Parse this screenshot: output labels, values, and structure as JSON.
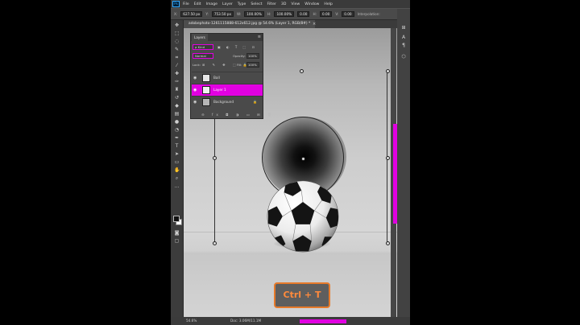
{
  "app": {
    "logo": "Ps",
    "menu": [
      "File",
      "Edit",
      "Image",
      "Layer",
      "Type",
      "Select",
      "Filter",
      "3D",
      "View",
      "Window",
      "Help"
    ]
  },
  "options_bar": {
    "x_label": "X:",
    "x": "627.50 px",
    "y_label": "Y:",
    "y": "753.50 px",
    "w_label": "W:",
    "w": "100.00%",
    "h_label": "H:",
    "h": "100.00%",
    "angle": "0.00",
    "hskew_label": "H:",
    "hskew": "0.00",
    "vskew_label": "V:",
    "vskew": "0.00",
    "interp": "Interpolation:"
  },
  "document": {
    "tab_title": "adobephoto-1261115888-612x612.jpg @ 54.6% (Layer 1, RGB/8#) *",
    "close": "×"
  },
  "layers_panel": {
    "tab": "Layers",
    "menu_icon": "≡",
    "kind": "ρ Kind",
    "filter_icons": "▣ ◐ T ⬚ ⊡",
    "blend_mode": "Normal",
    "opacity_label": "Opacity:",
    "opacity": "100%",
    "lock_label": "Lock:",
    "lock_icons": "⊞ ✎ ✥ ⬚ 🔒",
    "fill_label": "Fill:",
    "fill": "100%",
    "layers": [
      {
        "name": "Ball",
        "selected": false
      },
      {
        "name": "Layer 1",
        "selected": true
      },
      {
        "name": "Background",
        "selected": false,
        "locked": true
      }
    ],
    "footer_icons": "⊖ fx ◘ ◑ ▭ ⊞ 🗑"
  },
  "status": {
    "zoom": "54.6%",
    "doc": "Doc: 3.06M/11.1M"
  },
  "overlay": {
    "shortcut": "Ctrl + T"
  },
  "colors": {
    "accent": "#e100e1",
    "overlay_border": "#e77a2a",
    "overlay_text": "#ff8a3c"
  }
}
